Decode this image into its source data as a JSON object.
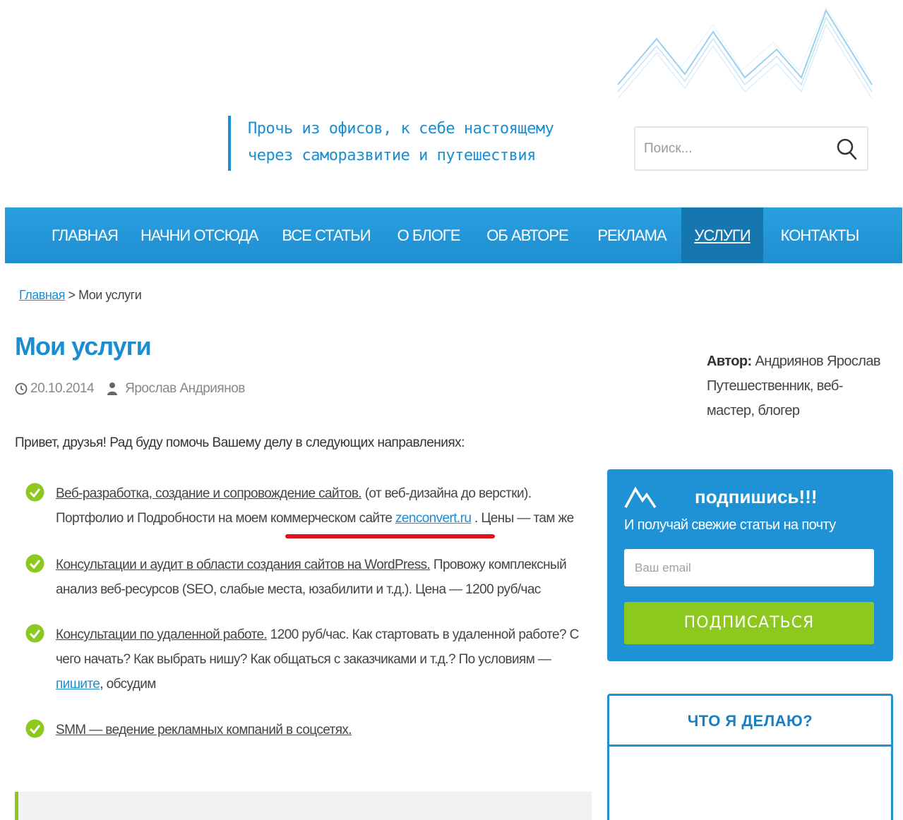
{
  "header": {
    "tagline_line1": "Прочь из офисов, к себе настоящему",
    "tagline_line2": "через саморазвитие и путешествия",
    "logo_icon": "mountains-logo-icon",
    "search": {
      "placeholder": "Поиск...",
      "icon": "search-icon"
    }
  },
  "nav": {
    "items": [
      {
        "label": "ГЛАВНАЯ"
      },
      {
        "label": "НАЧНИ ОТСЮДА"
      },
      {
        "label": "ВСЕ СТАТЬИ"
      },
      {
        "label": "О БЛОГЕ"
      },
      {
        "label": "ОБ АВТОРЕ"
      },
      {
        "label": "РЕКЛАМА"
      },
      {
        "label": "УСЛУГИ",
        "active": true
      },
      {
        "label": "КОНТАКТЫ"
      }
    ],
    "colors": {
      "background": "#2a9fe0",
      "active": "#1676b0"
    }
  },
  "breadcrumb": {
    "home": "Главная",
    "separator": ">",
    "current": "Мои услуги"
  },
  "article": {
    "title": "Мои услуги",
    "date": "20.10.2014",
    "author": "Ярослав Андриянов",
    "intro": "Привет, друзья! Рад буду помочь Вашему делу в следующих направлениях:",
    "services": [
      {
        "link": "Веб-разработка, создание и сопровождение сайтов.",
        "text1": " (от веб-дизайна до верстки). Портфолио и Подробности на моем коммерческом сайте ",
        "site": "zenconvert.ru",
        "text2": " . Цены — там же"
      },
      {
        "link": "Консультации и аудит в области создания сайтов на WordPress.",
        "text1": " Провожу комплексный анализ веб-ресурсов (SEO, слабые места, юзабилити и т.д.). Цена — 1200 руб/час"
      },
      {
        "link": "Консультации по удаленной работе.",
        "text1": " 1200 руб/час. Как стартовать в удаленной работе? С чего начать? Как выбрать нишу? Как общаться с заказчиками и т.д.? По условиям — ",
        "write": "пишите",
        "text2": ", обсудим"
      },
      {
        "link": "SMM — ведение рекламных компаний в соцсетях."
      }
    ]
  },
  "sidebar": {
    "author_label": "Автор:",
    "author_name": " Андриянов Ярослав",
    "author_desc": "Путешественник, веб-мастер, блогер",
    "subscribe": {
      "title": "подпишись!!!",
      "desc": "И получай свежие статьи на почту",
      "email_placeholder": "Ваш email",
      "button": "ПОДПИСАТЬСЯ",
      "colors": {
        "panel": "#1f92d6",
        "button": "#8cc81e"
      }
    },
    "whatdo_title": "ЧТО Я ДЕЛАЮ?"
  }
}
